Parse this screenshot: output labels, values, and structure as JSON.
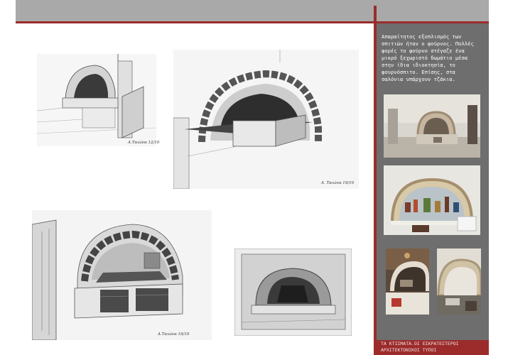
{
  "sidebar": {
    "caption": "Απαραίτητος εξοπλισμός των\nσπιτιών ήταν ο φούρνος. Πολλές\nφορές το φούρνο στέγαζε ένα\nμικρό ξεχωριστό δωμάτιο μέσα\nστην ίδια ιδιοκτησία, το\nφουρνόσπιτο. Επίσης, στα\nσαλόνια υπάρχουν τζάκια.",
    "footer": "ΤΑ ΚΤΙΣΜΑΤΑ.ΟΙ ΕΣΚΡΑΤΕΣΤΕΡΟΙ\nΑΡΧΙΤΕΚΤΟΝΙΚΟΙ ΤΥΠΟΙ"
  },
  "sketches": {
    "sketch_1_signature": "Α.Ταιώνα 12/10",
    "sketch_2_signature": "Α. Ταιώνα 19/10",
    "sketch_3_signature": "Α.Ταιώνα 19/10"
  },
  "colors": {
    "accent_red": "#9c2b2b",
    "band_gray": "#a9a9a9",
    "sidebar_gray": "#6e6e6e"
  }
}
